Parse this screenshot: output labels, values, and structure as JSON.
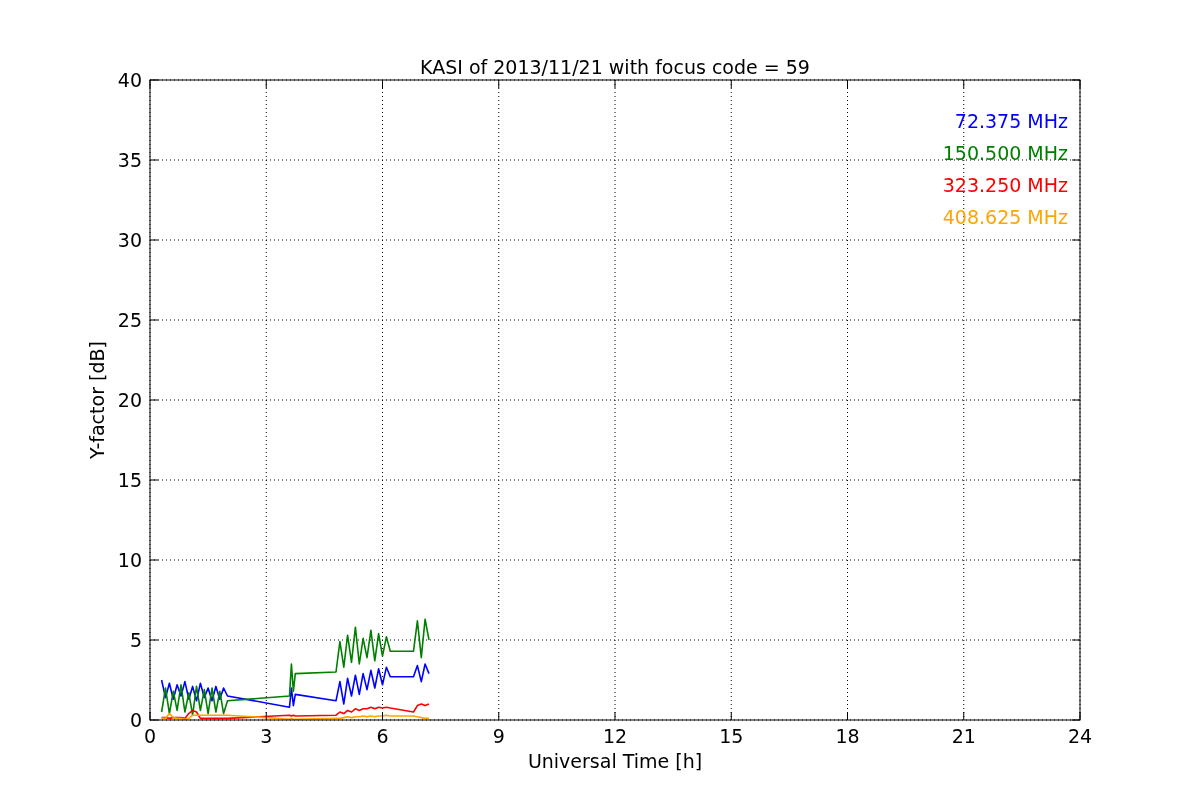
{
  "figure": {
    "chart_data": {
      "type": "line",
      "title": "KASI of 2013/11/21 with focus code = 59",
      "xlabel": "Universal Time [h]",
      "ylabel": "Y-factor [dB]",
      "xlim": [
        0,
        24
      ],
      "ylim": [
        0,
        40
      ],
      "xticks": [
        0,
        3,
        6,
        9,
        12,
        15,
        18,
        21,
        24
      ],
      "yticks": [
        0,
        5,
        10,
        15,
        20,
        25,
        30,
        35,
        40
      ],
      "grid": true,
      "x": [
        0.3,
        0.4,
        0.5,
        0.6,
        0.7,
        0.8,
        0.9,
        1.0,
        1.1,
        1.2,
        1.3,
        1.4,
        1.5,
        1.6,
        1.7,
        1.8,
        1.9,
        2.0,
        3.6,
        3.65,
        3.7,
        3.75,
        4.8,
        4.9,
        5.0,
        5.1,
        5.2,
        5.3,
        5.4,
        5.5,
        5.6,
        5.7,
        5.8,
        5.9,
        6.0,
        6.1,
        6.2,
        6.8,
        6.9,
        7.0,
        7.1,
        7.2
      ],
      "series": [
        {
          "name": "72.375 MHz",
          "color": "#0000ff",
          "values": [
            2.5,
            1.4,
            2.3,
            1.3,
            2.2,
            1.5,
            2.4,
            1.3,
            2.1,
            1.2,
            2.3,
            1.4,
            2.0,
            1.2,
            2.1,
            1.3,
            2.0,
            1.5,
            0.8,
            2.0,
            0.9,
            1.6,
            1.2,
            2.4,
            1.0,
            2.6,
            1.5,
            2.8,
            1.6,
            2.9,
            1.9,
            3.1,
            2.0,
            3.2,
            2.2,
            3.3,
            2.7,
            2.7,
            3.4,
            2.4,
            3.5,
            2.9
          ]
        },
        {
          "name": "150.500 MHz",
          "color": "#008000",
          "values": [
            0.5,
            2.0,
            0.4,
            1.8,
            0.6,
            2.2,
            0.5,
            1.7,
            0.3,
            2.1,
            0.6,
            1.9,
            0.4,
            2.0,
            0.5,
            1.8,
            0.4,
            1.2,
            1.5,
            3.5,
            1.8,
            2.9,
            3.0,
            4.9,
            3.3,
            5.3,
            3.6,
            5.8,
            3.5,
            5.1,
            3.9,
            5.6,
            3.7,
            5.4,
            4.0,
            5.2,
            4.3,
            4.3,
            6.2,
            3.9,
            6.3,
            5.0
          ]
        },
        {
          "name": "323.250 MHz",
          "color": "#ff0000",
          "values": [
            0.15,
            0.15,
            0.1,
            0.15,
            0.15,
            0.15,
            0.1,
            0.4,
            0.6,
            0.5,
            0.1,
            0.1,
            0.1,
            0.1,
            0.1,
            0.1,
            0.1,
            0.1,
            0.3,
            0.25,
            0.3,
            0.25,
            0.3,
            0.5,
            0.4,
            0.6,
            0.5,
            0.7,
            0.6,
            0.7,
            0.7,
            0.8,
            0.7,
            0.8,
            0.75,
            0.8,
            0.75,
            0.5,
            0.9,
            1.0,
            0.9,
            1.0
          ]
        },
        {
          "name": "408.625 MHz",
          "color": "#ffa500",
          "values": [
            0.1,
            0.1,
            0.4,
            0.15,
            0.1,
            0.1,
            0.05,
            0.1,
            0.3,
            0.3,
            0.3,
            0.3,
            0.3,
            0.3,
            0.3,
            0.3,
            0.3,
            0.3,
            0.05,
            0.1,
            0.05,
            0.05,
            0.1,
            0.1,
            0.15,
            0.2,
            0.15,
            0.2,
            0.2,
            0.25,
            0.2,
            0.25,
            0.2,
            0.25,
            0.25,
            0.3,
            0.25,
            0.25,
            0.2,
            0.15,
            0.1,
            0.1
          ]
        }
      ]
    }
  }
}
